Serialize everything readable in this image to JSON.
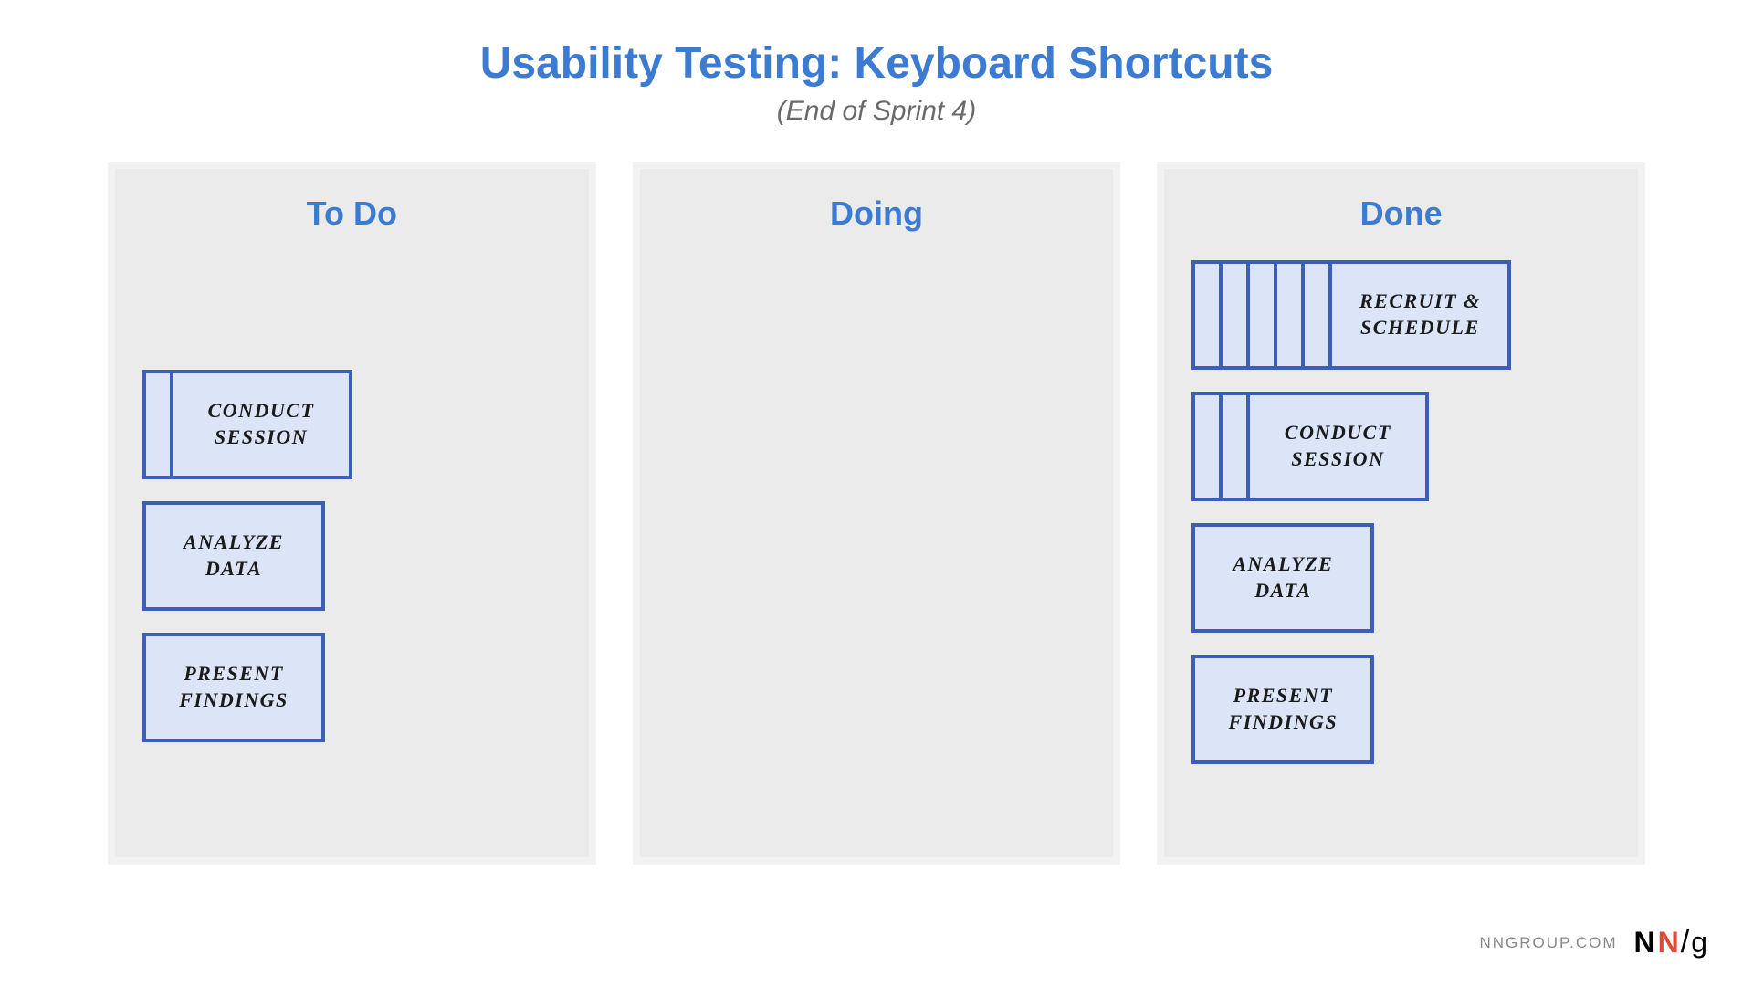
{
  "header": {
    "title": "Usability Testing: Keyboard Shortcuts",
    "subtitle": "(End of Sprint 4)"
  },
  "columns": {
    "todo": {
      "title": "To Do",
      "cards": [
        {
          "label": "CONDUCT SESSION",
          "stack": 2
        },
        {
          "label": "ANALYZE DATA",
          "stack": 1
        },
        {
          "label": "PRESENT FINDINGS",
          "stack": 1
        }
      ]
    },
    "doing": {
      "title": "Doing",
      "cards": []
    },
    "done": {
      "title": "Done",
      "cards": [
        {
          "label": "RECRUIT & SCHEDULE",
          "stack": 6
        },
        {
          "label": "CONDUCT SESSION",
          "stack": 3
        },
        {
          "label": "ANALYZE DATA",
          "stack": 1
        },
        {
          "label": "PRESENT FINDINGS",
          "stack": 1
        }
      ]
    }
  },
  "footer": {
    "text": "NNGROUP.COM"
  }
}
